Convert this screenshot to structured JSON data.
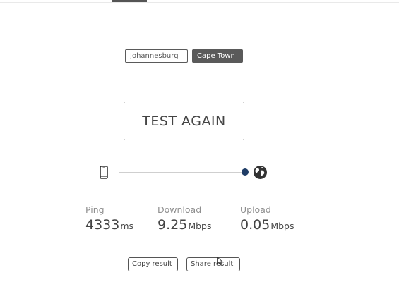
{
  "servers": {
    "options": [
      "Johannesburg",
      "Cape Town"
    ],
    "selected": "Cape Town"
  },
  "test_again_label": "TEST AGAIN",
  "progress": 1.0,
  "results": {
    "ping": {
      "label": "Ping",
      "value": "4333",
      "unit": "ms"
    },
    "download": {
      "label": "Download",
      "value": "9.25",
      "unit": "Mbps"
    },
    "upload": {
      "label": "Upload",
      "value": "0.05",
      "unit": "Mbps"
    }
  },
  "actions": {
    "copy_label": "Copy result",
    "share_label": "Share result"
  },
  "icons": {
    "device": "phone-icon",
    "server": "globe-icon",
    "pointer": "cursor-icon"
  },
  "colors": {
    "selected_server_bg": "#5a5a5a",
    "progress_dot": "#1f3d66",
    "label_gray": "#8f8f8f"
  }
}
